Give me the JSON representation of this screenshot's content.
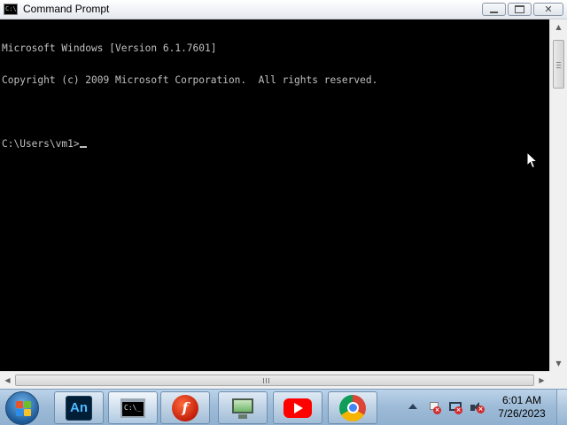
{
  "window": {
    "title": "Command Prompt",
    "app_icon_text": "C:\\",
    "minimize_icon": "minimize-icon",
    "maximize_icon": "maximize-icon",
    "close_icon": "close-icon",
    "close_glyph": "✕"
  },
  "console": {
    "lines": [
      "Microsoft Windows [Version 6.1.7601]",
      "Copyright (c) 2009 Microsoft Corporation.  All rights reserved.",
      "",
      "C:\\Users\\vm1>"
    ],
    "foreground": "#c0c0c0",
    "background": "#000000"
  },
  "scrollbars": {
    "up_glyph": "▲",
    "down_glyph": "▼",
    "left_glyph": "◀",
    "right_glyph": "▶"
  },
  "taskbar": {
    "start_icon": "windows-start-icon",
    "pinned": [
      {
        "name": "adobe-animate",
        "icon": "adobe-animate-icon",
        "label": "An"
      },
      {
        "name": "command-prompt",
        "icon": "command-prompt-icon",
        "label": "C:\\_",
        "active": true
      },
      {
        "name": "flash-player",
        "icon": "flash-player-icon",
        "label": "f"
      },
      {
        "name": "remote-desktop",
        "icon": "monitor-icon"
      },
      {
        "name": "youtube",
        "icon": "youtube-icon"
      },
      {
        "name": "chrome",
        "icon": "chrome-icon"
      }
    ],
    "tray_icons": [
      "show-hidden-icons-arrow",
      "action-center-flag-icon",
      "network-icon",
      "volume-muted-icon"
    ],
    "clock": {
      "time": "6:01 AM",
      "date": "7/26/2023"
    }
  }
}
